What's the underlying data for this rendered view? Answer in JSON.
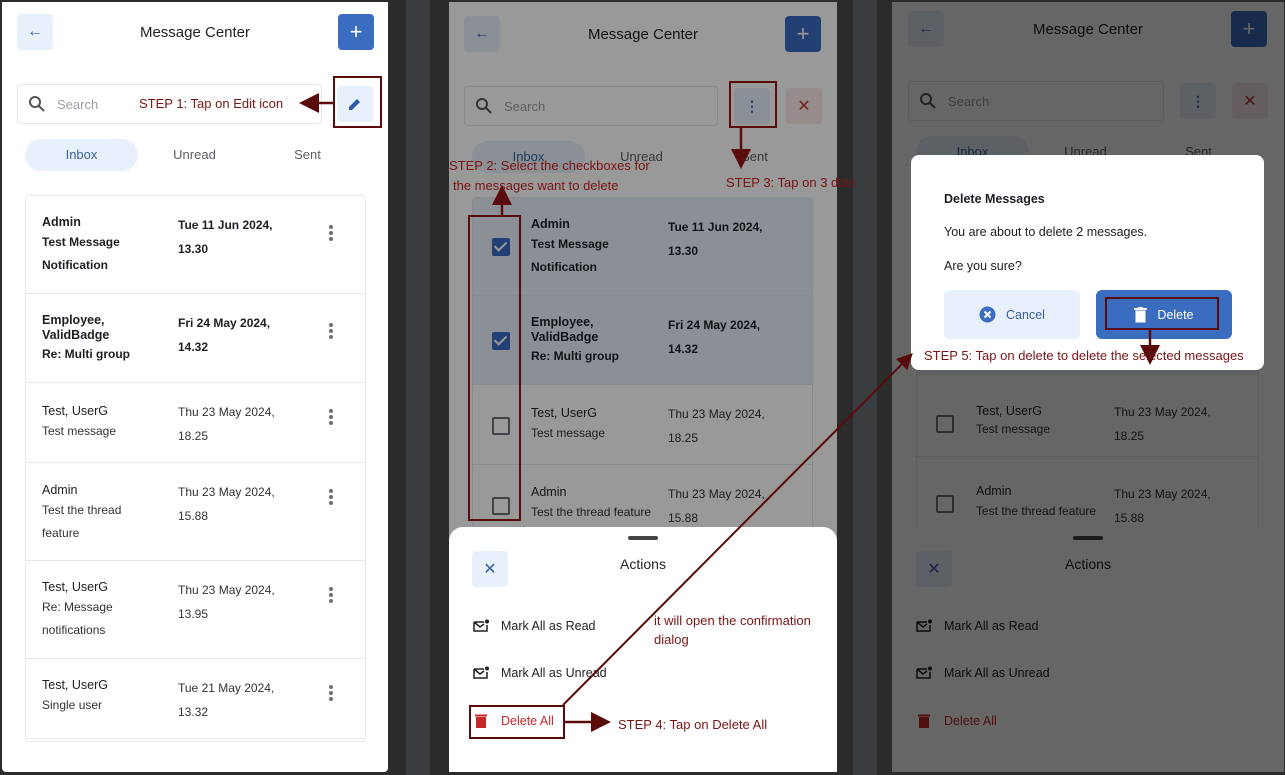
{
  "screens": [
    {
      "header": {
        "title": "Message Center",
        "back_icon": "arrow-left-icon",
        "add_icon": "plus-icon"
      },
      "search": {
        "placeholder": "Search"
      },
      "edit_icon": "pencil-icon",
      "tabs": [
        {
          "label": "Inbox",
          "active": true
        },
        {
          "label": "Unread"
        },
        {
          "label": "Sent"
        }
      ],
      "messages": [
        {
          "sender": "Admin",
          "subject": "Test Message Notification",
          "date": "Tue 11 Jun 2024,",
          "time": "13.30",
          "unread": true
        },
        {
          "sender": "Employee, ValidBadge",
          "subject": "Re: Multi group",
          "date": "Fri 24 May 2024,",
          "time": "14.32",
          "unread": true
        },
        {
          "sender": "Test, UserG",
          "subject": "Test message",
          "date": "Thu 23 May 2024,",
          "time": "18.25",
          "unread": false
        },
        {
          "sender": "Admin",
          "subject": "Test the thread feature",
          "date": "Thu 23 May 2024,",
          "time": "15.88",
          "unread": false
        },
        {
          "sender": "Test, UserG",
          "subject": "Re: Message notifications",
          "date": "Thu 23 May 2024,",
          "time": "13.95",
          "unread": false
        },
        {
          "sender": "Test, UserG",
          "subject": "Single user",
          "date": "Tue 21 May 2024,",
          "time": "13.32",
          "unread": false
        }
      ]
    },
    {
      "header": {
        "title": "Message Center"
      },
      "search": {
        "placeholder": "Search"
      },
      "tabs": [
        {
          "label": "Inbox",
          "active": true
        },
        {
          "label": "Unread"
        },
        {
          "label": "Sent"
        }
      ],
      "selected": [
        true,
        true,
        false,
        false
      ],
      "actions_sheet": {
        "title": "Actions",
        "items": [
          {
            "label": "Mark All as Read",
            "icon": "mail-mark-icon"
          },
          {
            "label": "Mark All as Unread",
            "icon": "mail-mark-icon"
          },
          {
            "label": "Delete All",
            "icon": "trash-icon",
            "danger": true
          }
        ]
      }
    },
    {
      "header": {
        "title": "Message Center"
      },
      "search": {
        "placeholder": "Search"
      },
      "tabs": [
        {
          "label": "Inbox",
          "active": true
        },
        {
          "label": "Unread"
        },
        {
          "label": "Sent"
        }
      ],
      "dialog": {
        "title": "Delete Messages",
        "message": "You are about to delete 2 messages.",
        "question": "Are you sure?",
        "cancel_label": "Cancel",
        "delete_label": "Delete"
      },
      "actions_sheet": {
        "title": "Actions",
        "items": [
          {
            "label": "Mark All as Read"
          },
          {
            "label": "Mark All as Unread"
          },
          {
            "label": "Delete All"
          }
        ]
      }
    }
  ],
  "annotations": {
    "step1": "STEP 1: Tap on Edit icon",
    "step2_line1": "STEP 2: Select the checkboxes for",
    "step2_line2": "the messages want to delete",
    "step3": "STEP 3: Tap on 3 dots",
    "step4": "STEP 4: Tap on Delete All",
    "step4_note_line1": "it will open the confirmation",
    "step4_note_line2": "dialog",
    "step5": "STEP 5: Tap on delete to delete the selected messages"
  },
  "colors": {
    "primary": "#3a6cc0",
    "primary_light": "#e8f1fb",
    "danger": "#c62828",
    "annotation": "#7a1414"
  }
}
